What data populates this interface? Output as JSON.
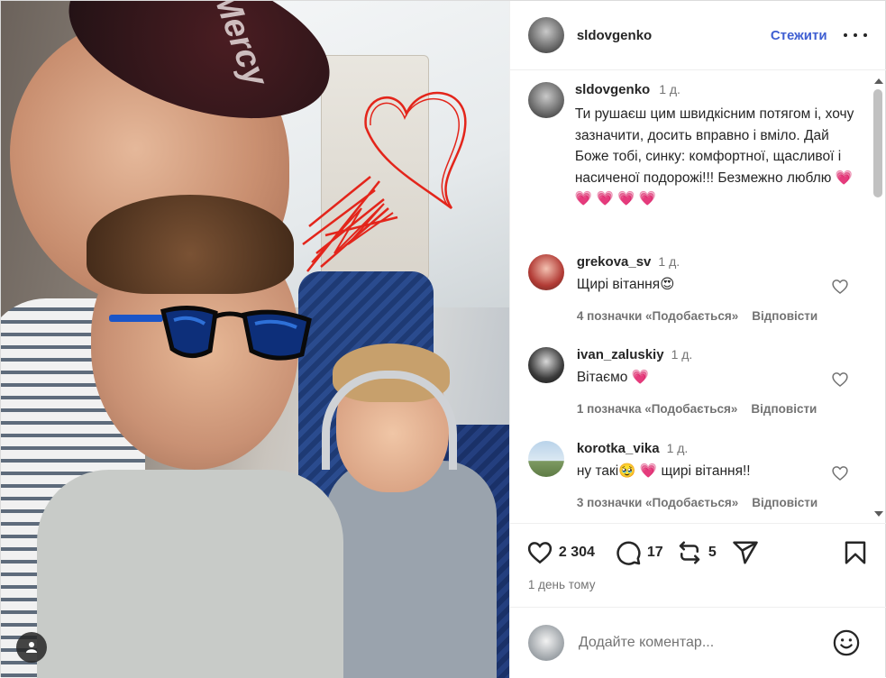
{
  "post": {
    "author": "sldovgenko",
    "follow_label": "Стежити",
    "caption": {
      "username": "sldovgenko",
      "time": "1 д.",
      "text": "Ти рушаєш цим швидкісним потягом і, хочу зазначити, досить вправно і вміло. Дай Боже тобі, синку: комфортної, щасливої і насиченої подорожі!!! Безмежно люблю ",
      "emoji": "💗 💗 💗 💗 💗"
    },
    "comments": [
      {
        "username": "grekova_sv",
        "time": "1 д.",
        "text": "Щирі вітання😍",
        "likes": "4 позначки «Подобається»",
        "reply": "Відповісти"
      },
      {
        "username": "ivan_zaluskiy",
        "time": "1 д.",
        "text": "Вітаємо 💗",
        "likes": "1 позначка «Подобається»",
        "reply": "Відповісти"
      },
      {
        "username": "korotka_vika",
        "time": "1 д.",
        "text": "ну такі🥹 💗 щирі вітання!!",
        "likes": "3 позначки «Подобається»",
        "reply": "Відповісти"
      }
    ],
    "like_count": "2 304",
    "comment_count": "17",
    "repost_count": "5",
    "date": "1 день тому",
    "add_comment_placeholder": "Додайте коментар...",
    "photo_cap_text": "Mercy"
  },
  "colors": {
    "follow": "#3f5fd2",
    "heart": "#e8245d"
  },
  "icons": [
    "user-tag-icon",
    "more-options-icon",
    "heart-icon",
    "comment-icon",
    "repost-icon",
    "share-icon",
    "save-icon",
    "emoji-icon"
  ]
}
